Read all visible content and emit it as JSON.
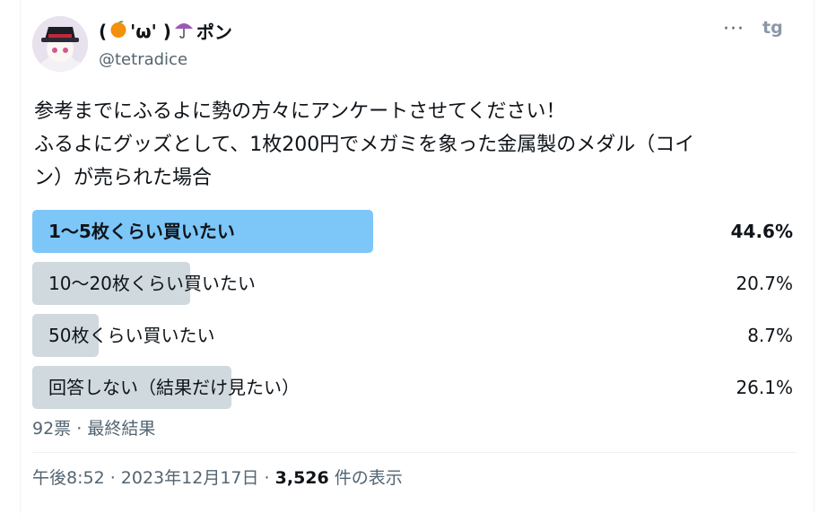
{
  "author": {
    "display_name_prefix": "(",
    "display_name_face": "'ω' )",
    "display_name_suffix": "ポン",
    "orange_icon": "orange-emoji",
    "umbrella_icon": "umbrella-emoji",
    "handle": "@tetradice"
  },
  "header": {
    "more_label": "···",
    "brand_label": "tg"
  },
  "tweet": {
    "text": "参考までにふるよに勢の方々にアンケートさせてください！\nふるよにグッズとして、1枚200円でメガミを象った金属製のメダル（コイ\nン）が売られた場合"
  },
  "poll": {
    "options": [
      {
        "label": "1〜5枚くらい買いたい",
        "percent_text": "44.6%",
        "percent": 44.6,
        "winner": true
      },
      {
        "label": "10〜20枚くらい買いたい",
        "percent_text": "20.7%",
        "percent": 20.7,
        "winner": false
      },
      {
        "label": "50枚くらい買いたい",
        "percent_text": "8.7%",
        "percent": 8.7,
        "winner": false
      },
      {
        "label": "回答しない（結果だけ見たい）",
        "percent_text": "26.1%",
        "percent": 26.1,
        "winner": false
      }
    ],
    "votes": "92票",
    "separator": " · ",
    "status": "最終結果"
  },
  "meta": {
    "time": "午後8:52",
    "date": "2023年12月17日",
    "separator": " · ",
    "views_count": "3,526",
    "views_suffix": " 件の表示"
  },
  "colors": {
    "winner_bar": "#7dc6f8",
    "other_bar": "#cfd9de",
    "secondary_text": "#536471"
  }
}
